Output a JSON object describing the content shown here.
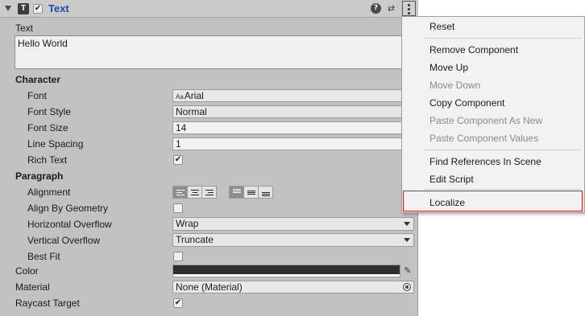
{
  "component": {
    "icon_letter": "T",
    "enabled_check": "✔",
    "title": "Text",
    "help_icon": "?",
    "preset_icon": "⇄"
  },
  "text": {
    "label": "Text",
    "value": "Hello World"
  },
  "character": {
    "header": "Character",
    "font_label": "Font",
    "font_prefix": "Aa",
    "font_value": "Arial",
    "font_style_label": "Font Style",
    "font_style_value": "Normal",
    "font_size_label": "Font Size",
    "font_size_value": "14",
    "line_spacing_label": "Line Spacing",
    "line_spacing_value": "1",
    "rich_text_label": "Rich Text",
    "rich_text_check": "✔"
  },
  "paragraph": {
    "header": "Paragraph",
    "alignment_label": "Alignment",
    "align_by_geometry_label": "Align By Geometry",
    "horizontal_overflow_label": "Horizontal Overflow",
    "horizontal_overflow_value": "Wrap",
    "vertical_overflow_label": "Vertical Overflow",
    "vertical_overflow_value": "Truncate",
    "best_fit_label": "Best Fit"
  },
  "color": {
    "label": "Color",
    "swatch": "#2e2e2e"
  },
  "material": {
    "label": "Material",
    "value": "None (Material)"
  },
  "raycast": {
    "label": "Raycast Target",
    "check": "✔"
  },
  "menu": {
    "reset": "Reset",
    "remove_component": "Remove Component",
    "move_up": "Move Up",
    "move_down": "Move Down",
    "copy_component": "Copy Component",
    "paste_as_new": "Paste Component As New",
    "paste_values": "Paste Component Values",
    "find_references": "Find References In Scene",
    "edit_script": "Edit Script",
    "localize": "Localize"
  },
  "colors": {
    "title_blue": "#1f4ea8",
    "highlight_red": "#d21f1f",
    "panel_bg": "#c2c2c2",
    "menu_bg": "#f2f2f2"
  }
}
